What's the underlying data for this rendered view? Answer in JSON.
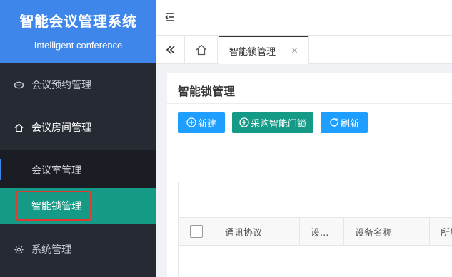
{
  "brand": {
    "title": "智能会议管理系统",
    "subtitle": "Intelligent conference"
  },
  "sidebar": {
    "items": [
      {
        "label": "会议预约管理",
        "icon": "link-icon"
      },
      {
        "label": "会议房间管理",
        "icon": "home-icon"
      },
      {
        "label": "系统管理",
        "icon": "gear-icon"
      }
    ],
    "submenu": [
      {
        "label": "会议室管理"
      },
      {
        "label": "智能锁管理",
        "active": true
      }
    ]
  },
  "tabs": {
    "active_label": "智能锁管理",
    "close": "×"
  },
  "page": {
    "title": "智能锁管理",
    "buttons": {
      "new": "新建",
      "buy": "采购智能门锁",
      "refresh": "刷新"
    }
  },
  "table": {
    "columns": [
      "通讯协议",
      "设...",
      "设备名称",
      "所属"
    ]
  },
  "colors": {
    "brand_blue": "#3f86ea",
    "sidebar_bg": "#252a33",
    "active_teal": "#149a86",
    "button_blue": "#1e9fff",
    "highlight_red": "#e03a2e"
  }
}
